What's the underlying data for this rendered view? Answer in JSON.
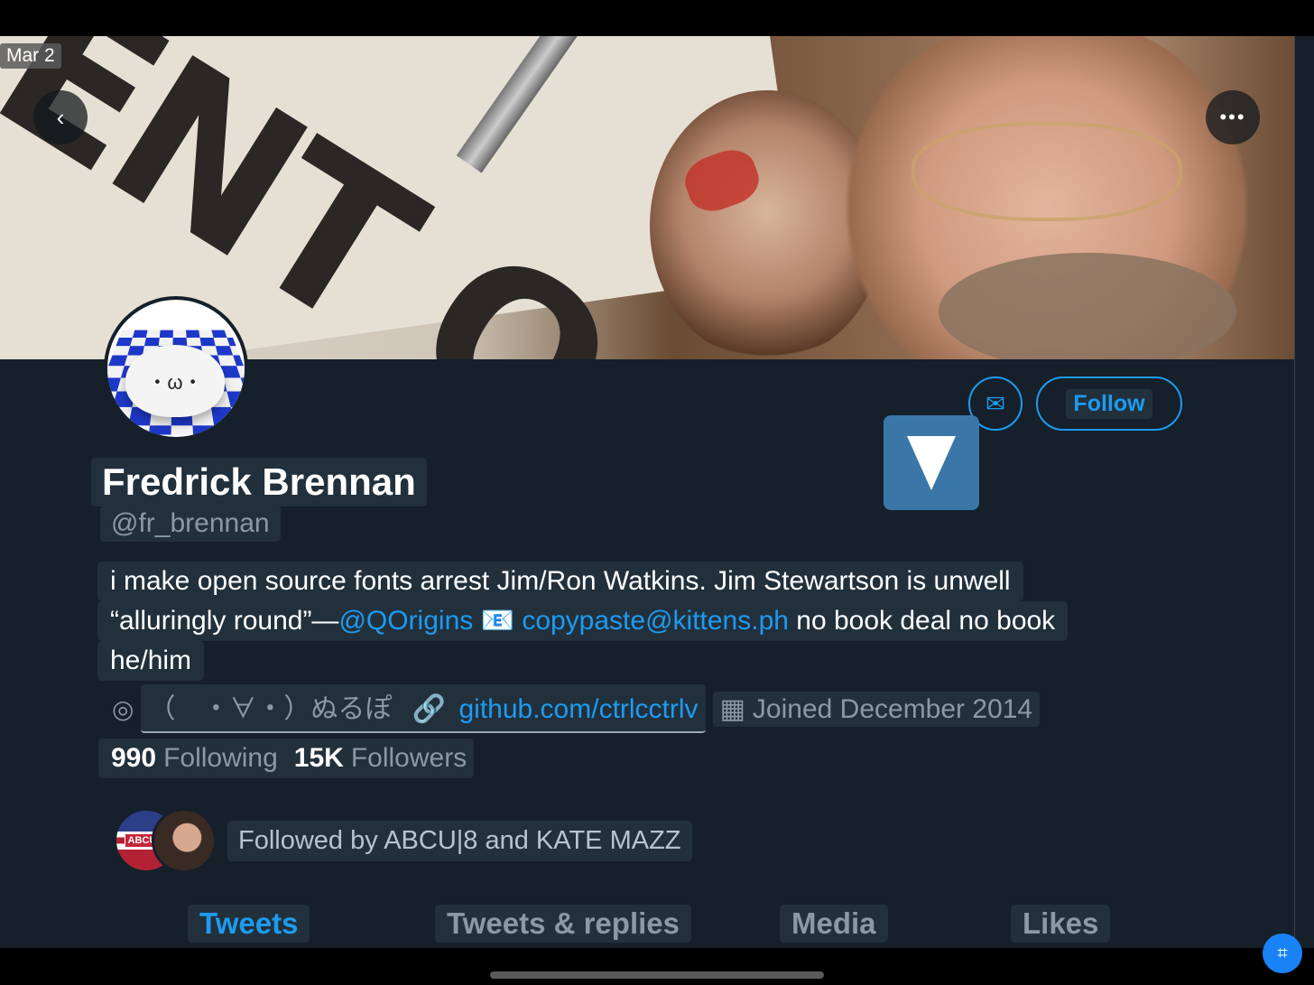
{
  "banner": {
    "date_tag": "Mar 2",
    "sign_text": "ENT Q"
  },
  "nav": {
    "back_icon": "‹",
    "more_icon": "•••"
  },
  "profile": {
    "avatar_face": "・ω・",
    "name": "Fredrick Brennan",
    "handle": "@fr_brennan",
    "follow_label": "Follow",
    "bio": {
      "line1": "i make open source fonts arrest Jim/Ron Watkins. Jim Stewartson is unwell",
      "line2_prefix": "“alluringly round”—",
      "line2_mention": "@QOrigins",
      "line2_mail_icon": "📧",
      "line2_email": "copypaste@kittens.ph",
      "line2_suffix": "no book deal no book",
      "line3": "he/him"
    },
    "location": "（　・∀・）ぬるぽ",
    "website": "github.com/ctrlcctrlv",
    "joined": "Joined December 2014",
    "following_count": "990",
    "following_label": "Following",
    "followers_count": "15K",
    "followers_label": "Followers",
    "followed_by_badge": "ABCU|8",
    "followed_by": "Followed by ABCU|8 and KATE MAZZ"
  },
  "tabs": [
    {
      "label": "Tweets"
    },
    {
      "label": "Tweets & replies"
    },
    {
      "label": "Media"
    },
    {
      "label": "Likes"
    }
  ],
  "colors": {
    "accent": "#1d9bf0",
    "background": "#15202b",
    "text_secondary": "#8b98a5"
  }
}
